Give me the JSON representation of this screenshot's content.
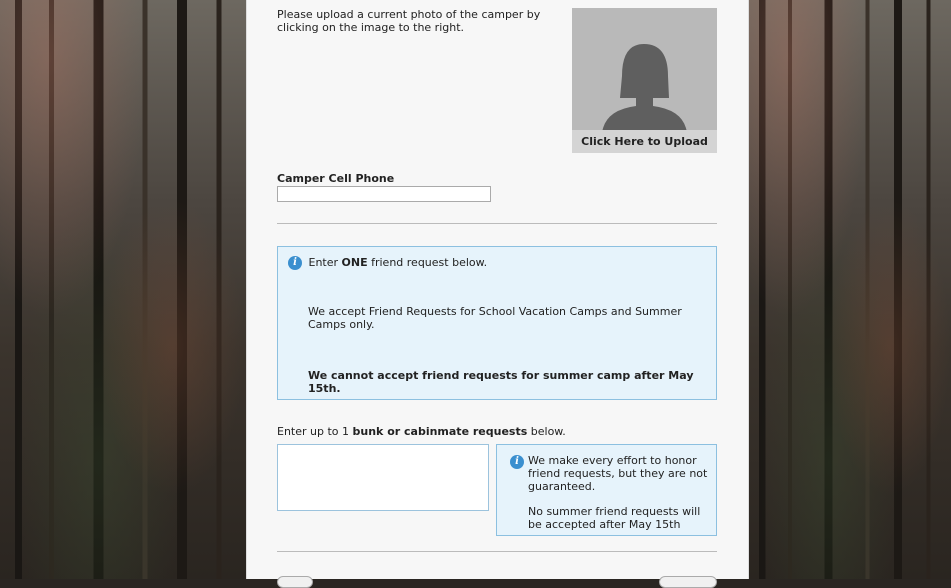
{
  "upload": {
    "instructions": "Please upload a current photo of the camper by clicking on the image to the right.",
    "button_caption": "Click Here to Upload"
  },
  "camper_phone": {
    "label": "Camper Cell Phone",
    "value": ""
  },
  "friend_info": {
    "line1_pre": "Enter ",
    "line1_bold": "ONE",
    "line1_post": " friend request below.",
    "paragraph2": "We accept Friend Requests for School Vacation Camps and Summer Camps only.",
    "paragraph3": "We cannot accept friend requests for summer camp after May 15th."
  },
  "bunk": {
    "label_pre": "Enter up to 1 ",
    "label_bold": "bunk or cabinmate requests",
    "label_post": " below.",
    "value": ""
  },
  "note": {
    "paragraph1": "We make every effort to honor friend requests, but they are not guaranteed.",
    "paragraph2": "No summer friend requests will be accepted after May 15th"
  },
  "colors": {
    "info_bg": "#e6f3fb",
    "info_border": "#8cc0e0",
    "info_icon": "#3a8fcf"
  },
  "icons": {
    "info": "info-icon",
    "avatar": "person-silhouette-icon"
  }
}
